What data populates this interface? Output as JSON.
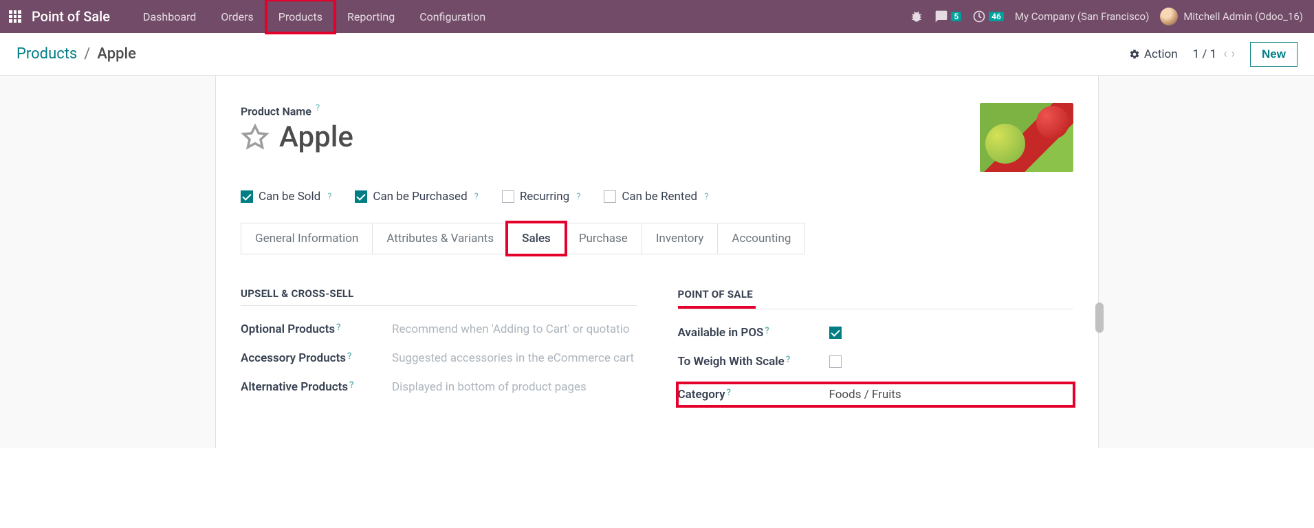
{
  "nav": {
    "brand": "Point of Sale",
    "items": [
      "Dashboard",
      "Orders",
      "Products",
      "Reporting",
      "Configuration"
    ],
    "highlighted_index": 2,
    "messages_badge": "5",
    "activities_badge": "46",
    "company": "My Company (San Francisco)",
    "user": "Mitchell Admin (Odoo_16)"
  },
  "breadcrumb": {
    "root": "Products",
    "sep": "/",
    "current": "Apple"
  },
  "controlbar": {
    "action": "Action",
    "pager": "1 / 1",
    "new": "New"
  },
  "form": {
    "product_name_label": "Product Name",
    "product_name": "Apple",
    "options": {
      "can_be_sold": {
        "label": "Can be Sold",
        "checked": true
      },
      "can_be_purchased": {
        "label": "Can be Purchased",
        "checked": true
      },
      "recurring": {
        "label": "Recurring",
        "checked": false
      },
      "can_be_rented": {
        "label": "Can be Rented",
        "checked": false
      }
    },
    "tabs": [
      "General Information",
      "Attributes & Variants",
      "Sales",
      "Purchase",
      "Inventory",
      "Accounting"
    ],
    "active_tab_index": 2,
    "sales": {
      "left_header": "UPSELL & CROSS-SELL",
      "optional_label": "Optional Products",
      "optional_placeholder": "Recommend when 'Adding to Cart' or quotatio",
      "accessory_label": "Accessory Products",
      "accessory_placeholder": "Suggested accessories in the eCommerce cart",
      "alternative_label": "Alternative Products",
      "alternative_placeholder": "Displayed in bottom of product pages",
      "right_header": "POINT OF SALE",
      "available_pos_label": "Available in POS",
      "available_pos_checked": true,
      "weigh_label": "To Weigh With Scale",
      "weigh_checked": false,
      "category_label": "Category",
      "category_value": "Foods / Fruits"
    }
  }
}
